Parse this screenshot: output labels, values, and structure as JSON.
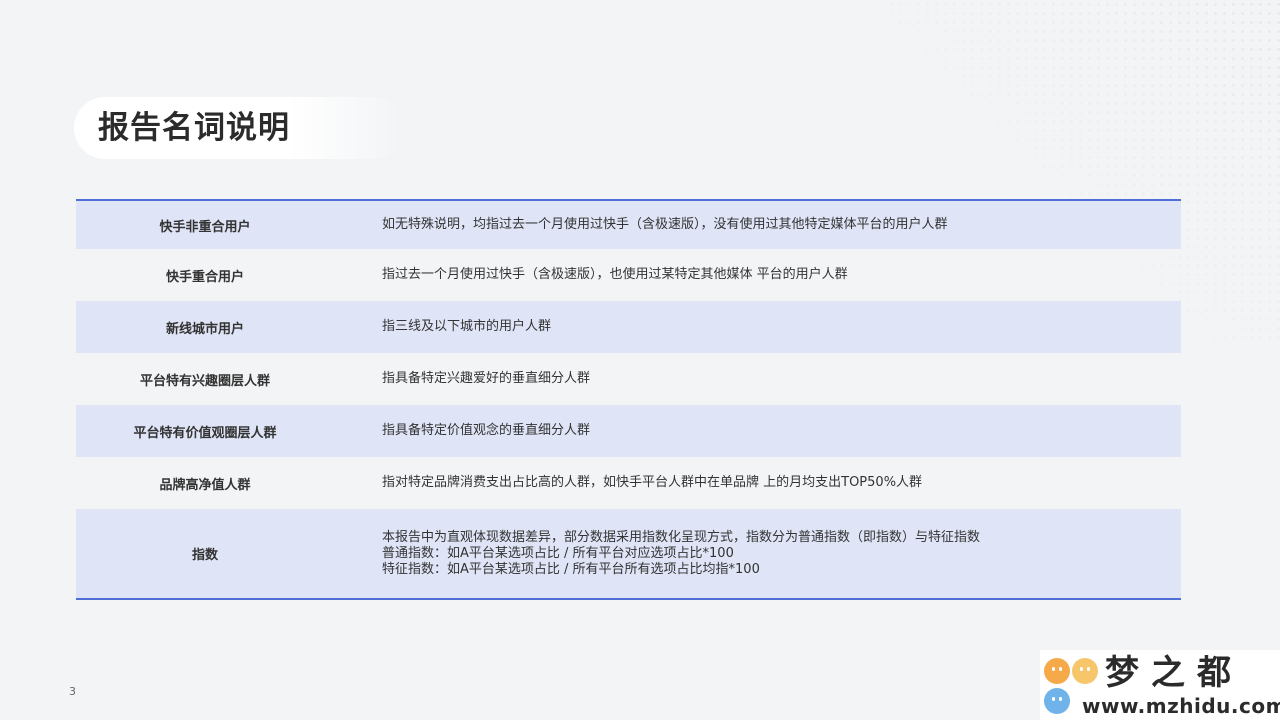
{
  "slide": {
    "title": "报告名词说明",
    "page_number": "3"
  },
  "terms": [
    {
      "term": "快手非重合用户",
      "definition": [
        "如无特殊说明，均指过去一个月使用过快手（含极速版），没有使用过其他特定媒体平台的用户人群"
      ]
    },
    {
      "term": "快手重合用户",
      "definition": [
        "指过去一个月使用过快手（含极速版），也使用过某特定其他媒体 平台的用户人群"
      ]
    },
    {
      "term": "新线城市用户",
      "definition": [
        "指三线及以下城市的用户人群"
      ]
    },
    {
      "term": "平台特有兴趣圈层人群",
      "definition": [
        "指具备特定兴趣爱好的垂直细分人群"
      ]
    },
    {
      "term": "平台特有价值观圈层人群",
      "definition": [
        "指具备特定价值观念的垂直细分人群"
      ]
    },
    {
      "term": "品牌高净值人群",
      "definition": [
        "指对特定品牌消费支出占比高的人群，如快手平台人群中在单品牌 上的月均支出TOP50%人群"
      ]
    },
    {
      "term": "指数",
      "definition": [
        "本报告中为直观体现数据差异，部分数据采用指数化呈现方式，指数分为普通指数（即指数）与特征指数",
        "普通指数：如A平台某选项占比 / 所有平台对应选项占比*100",
        "特征指数：如A平台某选项占比 / 所有平台所有选项占比均指*100"
      ]
    }
  ],
  "watermark": {
    "logo_text": "梦之都",
    "url": "www.mzhidu.com"
  },
  "colors": {
    "accent_line": "#4f6ed6",
    "row_band": "#dfe4f7",
    "background": "#f2f4f6"
  }
}
